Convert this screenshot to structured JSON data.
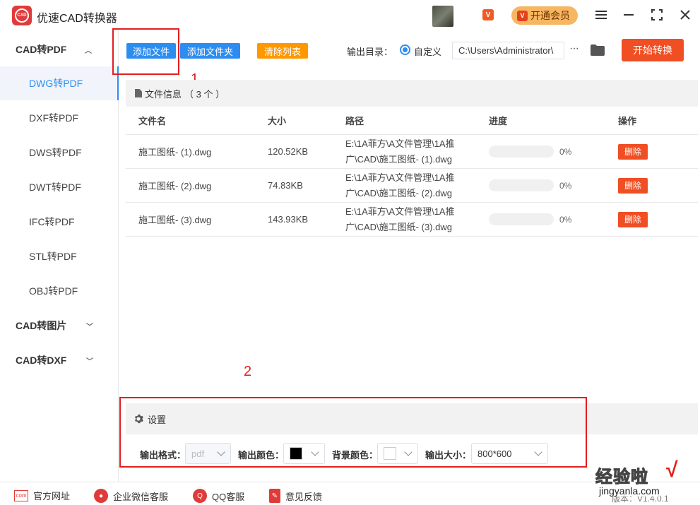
{
  "app": {
    "title": "优速CAD转换器",
    "logo_text": "CAD"
  },
  "titlebar": {
    "vip_badge": "V",
    "vip_icon": "V",
    "vip_label": "开通会员"
  },
  "sidebar": {
    "groups": [
      {
        "label": "CAD转PDF",
        "expanded": true
      },
      {
        "label": "CAD转图片",
        "expanded": false
      },
      {
        "label": "CAD转DXF",
        "expanded": false
      }
    ],
    "items": [
      "DWG转PDF",
      "DXF转PDF",
      "DWS转PDF",
      "DWT转PDF",
      "IFC转PDF",
      "STL转PDF",
      "OBJ转PDF"
    ],
    "active_item": "DWG转PDF"
  },
  "toolbar": {
    "add_file": "添加文件",
    "add_folder": "添加文件夹",
    "clear_list": "清除列表",
    "output_label": "输出目录：",
    "custom_label": "自定义",
    "output_path": "C:\\Users\\Administrator\\",
    "more": "···",
    "start": "开始转换"
  },
  "annotations": {
    "one": "1",
    "two": "2"
  },
  "file_info": {
    "label": "文件信息",
    "count_text": "（ 3 个 ）"
  },
  "table": {
    "headers": [
      "文件名",
      "大小",
      "路径",
      "进度",
      "操作"
    ],
    "rows": [
      {
        "name": "施工图纸- (1).dwg",
        "size": "120.52KB",
        "path_line1": "E:\\1A菲方\\A文件管理\\1A推",
        "path_line2": "广\\CAD\\施工图纸- (1).dwg",
        "progress": 0,
        "progress_text": "0%",
        "action": "删除"
      },
      {
        "name": "施工图纸- (2).dwg",
        "size": "74.83KB",
        "path_line1": "E:\\1A菲方\\A文件管理\\1A推",
        "path_line2": "广\\CAD\\施工图纸- (2).dwg",
        "progress": 0,
        "progress_text": "0%",
        "action": "删除"
      },
      {
        "name": "施工图纸- (3).dwg",
        "size": "143.93KB",
        "path_line1": "E:\\1A菲方\\A文件管理\\1A推",
        "path_line2": "广\\CAD\\施工图纸- (3).dwg",
        "progress": 0,
        "progress_text": "0%",
        "action": "删除"
      }
    ]
  },
  "settings": {
    "title": "设置",
    "format_label": "输出格式：",
    "format_value": "pdf",
    "color_label": "输出颜色：",
    "color_value": "#000000",
    "bg_label": "背景颜色：",
    "bg_value": "#ffffff",
    "size_label": "输出大小：",
    "size_value": "800*600"
  },
  "footer": {
    "links": [
      "官方网址",
      "企业微信客服",
      "QQ客服",
      "意见反馈"
    ],
    "version": "版本：V1.4.0.1"
  },
  "watermark": {
    "title": "经验啦",
    "check": "√",
    "url": "jingyanla.com"
  },
  "colors": {
    "accent": "#2d8cf0",
    "danger": "#f04e23",
    "clear": "#ff9800",
    "annotation": "#e31e1e"
  }
}
